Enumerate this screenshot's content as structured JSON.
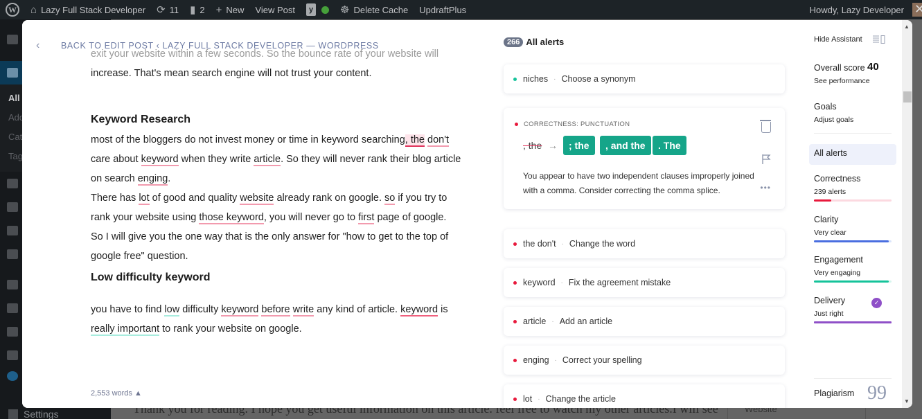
{
  "adminbar": {
    "site_name": "Lazy Full Stack Developer",
    "updates_count": "11",
    "comments_count": "2",
    "new_label": "New",
    "view_post_label": "View Post",
    "delete_cache_label": "Delete Cache",
    "updraft_label": "UpdraftPlus",
    "howdy": "Howdy, Lazy Developer"
  },
  "wp_sidebar": {
    "submenu": [
      "All",
      "Add",
      "Cat",
      "Tag"
    ],
    "settings_label": "Settings"
  },
  "behind": {
    "text": "Thank you for reading. I hope you get useful information on this article. feel free to watch my other articles.I will see",
    "website_label": "Website"
  },
  "editor": {
    "back_label": "BACK TO EDIT POST ‹ LAZY FULL STACK DEVELOPER — WORDPRESS",
    "faded_line": "exit your website within a few seconds. So the bounce rate of your website will",
    "line_increase": "increase. That's mean search engine will not trust your content.",
    "heading1": "Keyword Research",
    "p1": {
      "a": "most of the bloggers do not invest money or time in keyword searching",
      "b": ", the",
      "c": "don't",
      "d": " care about ",
      "e": "keyword",
      "f": " when they write ",
      "g": "article",
      "h": ". So they will never rank their blog article on search ",
      "i": "enging",
      "j": "."
    },
    "p2": {
      "a": "There has ",
      "b": "lot",
      "c": " of good and quality ",
      "d": "website",
      "e": " already rank on google. ",
      "f": "so",
      "g": " if you try to rank your website using ",
      "h": "those keyword",
      "i": ", you will never go to ",
      "j": "first",
      "k": " page of google."
    },
    "p3": "So I will give you the one way that is the only answer for \"how to get to the top of google free\" question.",
    "heading2": "Low difficulty keyword",
    "p4": {
      "a": "you have to find ",
      "b": "low",
      "c": " difficulty ",
      "d": "keyword",
      "e": " ",
      "f": "before",
      "g": " ",
      "h": "write",
      "i": " any kind of article. ",
      "j": "keyword",
      "k": " is ",
      "l": "really important",
      "m": " to rank your website on google."
    },
    "word_count": "2,553 words ▲"
  },
  "alerts": {
    "count": "266",
    "title": "All alerts",
    "items": [
      {
        "word": "niches",
        "action": "Choose a synonym",
        "color": "#15c39a"
      },
      {
        "word": "the don't",
        "action": "Change the word",
        "color": "#e8193c"
      },
      {
        "word": "keyword",
        "action": "Fix the agreement mistake",
        "color": "#e8193c"
      },
      {
        "word": "article",
        "action": "Add an article",
        "color": "#e8193c"
      },
      {
        "word": "enging",
        "action": "Correct your spelling",
        "color": "#e8193c"
      },
      {
        "word": "lot",
        "action": "Change the article",
        "color": "#e8193c"
      }
    ],
    "expanded": {
      "category": "CORRECTNESS: PUNCTUATION",
      "original": ", the",
      "arrow": "→",
      "suggestions": [
        "; the",
        ", and the",
        ". The"
      ],
      "description": "You appear to have two independent clauses improperly joined with a comma. Consider correcting the comma splice.",
      "more": "•••"
    }
  },
  "panel": {
    "hide_assistant": "Hide Assistant",
    "overall_label": "Overall score",
    "overall_score": "40",
    "see_performance": "See performance",
    "goals_label": "Goals",
    "adjust_goals": "Adjust goals",
    "all_alerts": "All alerts",
    "categories": [
      {
        "name": "Correctness",
        "status": "239 alerts",
        "color": "#e8193c",
        "track": "#fcd9e0",
        "fill": 0.22
      },
      {
        "name": "Clarity",
        "status": "Very clear",
        "color": "#4a6ee0",
        "track": "#dbe6fb",
        "fill": 0.96
      },
      {
        "name": "Engagement",
        "status": "Very engaging",
        "color": "#15c39a",
        "track": "#d6f6ee",
        "fill": 0.96
      },
      {
        "name": "Delivery",
        "status": "Just right",
        "color": "#8f50c8",
        "track": "#8f50c8",
        "fill": 1.0
      }
    ],
    "plagiarism": "Plagiarism"
  },
  "colors": {
    "accent_green": "#15a589",
    "error_red": "#e8193c"
  }
}
